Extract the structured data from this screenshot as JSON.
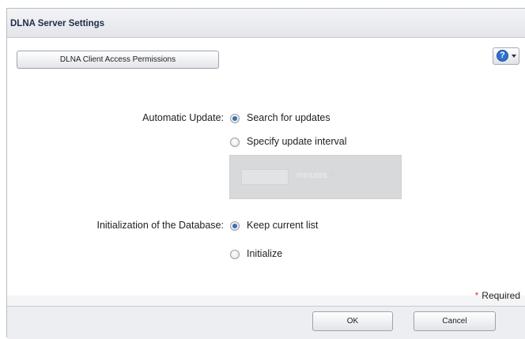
{
  "window": {
    "title": "DLNA Server Settings"
  },
  "toolbar": {
    "help_glyph": "?",
    "help_icon": "help-icon"
  },
  "access_button": {
    "label": "DLNA Client Access Permissions"
  },
  "automatic_update": {
    "label": "Automatic Update:",
    "options": [
      {
        "label": "Search for updates",
        "checked": true
      },
      {
        "label": "Specify update interval",
        "checked": false
      }
    ],
    "interval": {
      "value": "",
      "unit": "minutes",
      "required_mark": "*",
      "disabled": true
    }
  },
  "db_init": {
    "label": "Initialization of the Database:",
    "options": [
      {
        "label": "Keep current list",
        "checked": true
      },
      {
        "label": "Initialize",
        "checked": false
      }
    ]
  },
  "required": {
    "mark": "*",
    "label": "Required"
  },
  "footer": {
    "ok_label": "OK",
    "cancel_label": "Cancel"
  },
  "colors": {
    "accent": "#2f6fcf",
    "required_mark": "#e03a3a",
    "radio_selected": "#3e6fb3"
  }
}
